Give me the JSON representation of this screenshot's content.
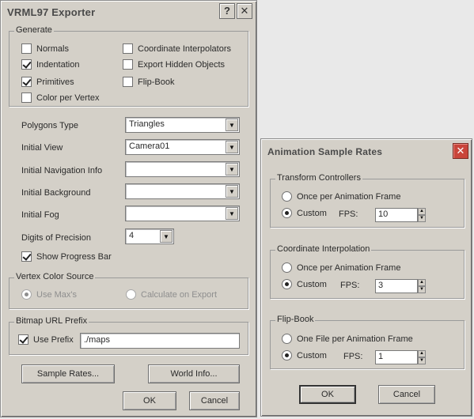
{
  "vrml": {
    "title": "VRML97 Exporter",
    "help_glyph": "?",
    "close_glyph": "✕",
    "generate": {
      "legend": "Generate",
      "normals": "Normals",
      "indentation": "Indentation",
      "primitives": "Primitives",
      "color_per_vertex": "Color per Vertex",
      "coordinate_interpolators": "Coordinate Interpolators",
      "export_hidden_objects": "Export Hidden Objects",
      "flip_book": "Flip-Book"
    },
    "polygons_type": {
      "label": "Polygons Type",
      "value": "Triangles"
    },
    "initial_view": {
      "label": "Initial View",
      "value": "Camera01"
    },
    "initial_navigation_info": {
      "label": "Initial Navigation Info",
      "value": ""
    },
    "initial_background": {
      "label": "Initial Background",
      "value": ""
    },
    "initial_fog": {
      "label": "Initial Fog",
      "value": ""
    },
    "digits_of_precision": {
      "label": "Digits of Precision",
      "value": "4"
    },
    "show_progress_bar": "Show Progress Bar",
    "vertex_color_source": {
      "legend": "Vertex Color Source",
      "use_max": "Use Max's",
      "calculate_on_export": "Calculate on Export"
    },
    "bitmap_url_prefix": {
      "legend": "Bitmap URL Prefix",
      "use_prefix": "Use Prefix",
      "value": "./maps"
    },
    "buttons": {
      "sample_rates": "Sample Rates...",
      "world_info": "World Info...",
      "ok": "OK",
      "cancel": "Cancel"
    }
  },
  "asr": {
    "title": "Animation Sample Rates",
    "close_glyph": "✕",
    "transform_controllers": {
      "legend": "Transform Controllers",
      "once": "Once per Animation Frame",
      "custom": "Custom",
      "fps_label": "FPS:",
      "fps": "10"
    },
    "coordinate_interpolation": {
      "legend": "Coordinate Interpolation",
      "once": "Once per Animation Frame",
      "custom": "Custom",
      "fps_label": "FPS:",
      "fps": "3"
    },
    "flip_book": {
      "legend": "Flip-Book",
      "once": "One File per Animation Frame",
      "custom": "Custom",
      "fps_label": "FPS:",
      "fps": "1"
    },
    "buttons": {
      "ok": "OK",
      "cancel": "Cancel"
    }
  },
  "glyphs": {
    "combo_arrow": "▼",
    "spin_up": "▲",
    "spin_down": "▼"
  }
}
